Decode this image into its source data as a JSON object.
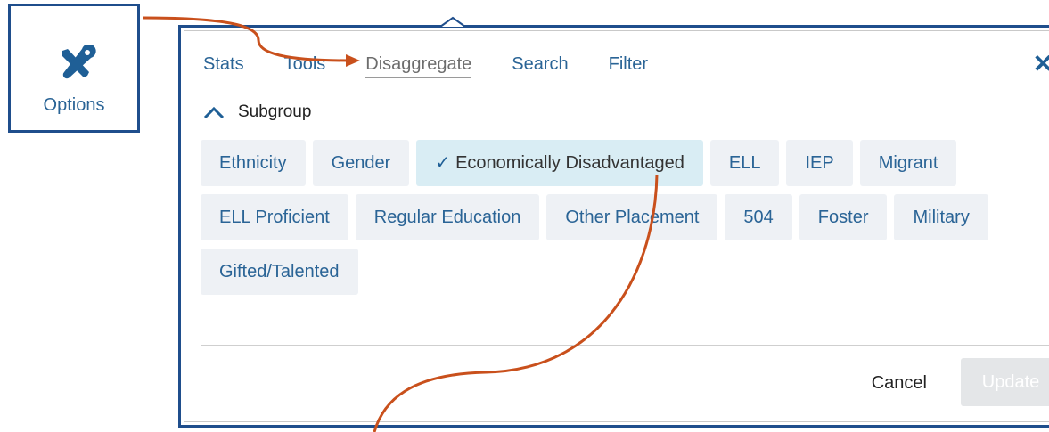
{
  "options": {
    "label": "Options",
    "icon": "tools-icon"
  },
  "tabs": [
    {
      "label": "Stats"
    },
    {
      "label": "Tools"
    },
    {
      "label": "Disaggregate",
      "active": true
    },
    {
      "label": "Search"
    },
    {
      "label": "Filter"
    }
  ],
  "close_icon": "close-icon",
  "subgroup": {
    "label": "Subgroup",
    "expanded": true
  },
  "chips": {
    "row1": [
      "Ethnicity",
      "Gender",
      "Economically Disadvantaged",
      "ELL",
      "IEP",
      "Migrant"
    ],
    "row2": [
      "ELL Proficient",
      "Regular Education",
      "Other Placement",
      "504",
      "Foster",
      "Military"
    ],
    "row3": [
      "Gifted/Talented"
    ],
    "selected": "Economically Disadvantaged"
  },
  "footer": {
    "cancel": "Cancel",
    "update": "Update",
    "update_disabled": true
  },
  "colors": {
    "accent": "#2a6496",
    "callout_border": "#1f4e8c",
    "arrow": "#c9501c",
    "chip_bg": "#eef1f5",
    "chip_selected_bg": "#d9edf4"
  }
}
